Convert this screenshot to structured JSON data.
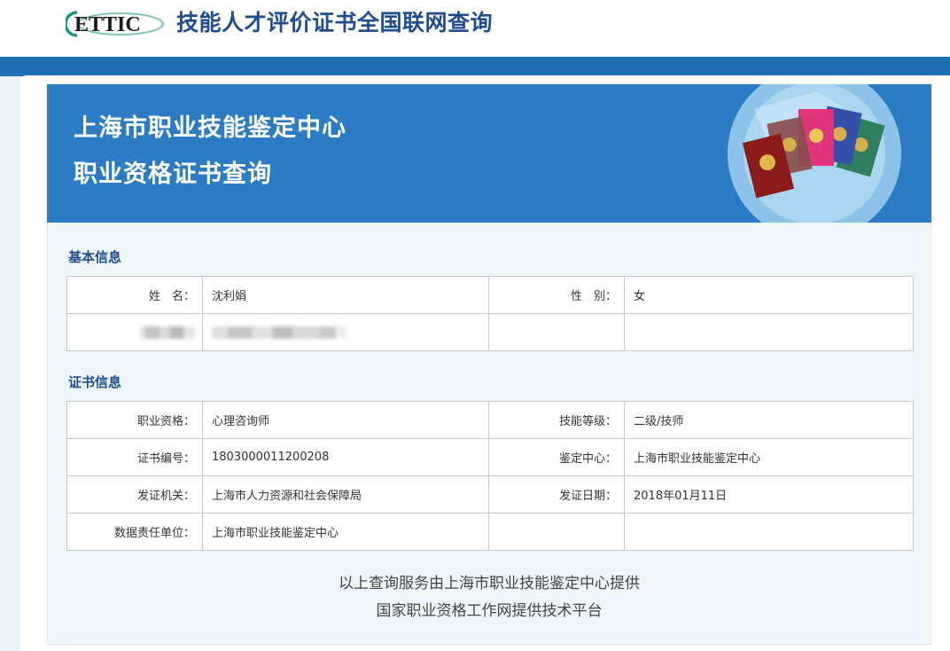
{
  "header": {
    "logo_text": "ETTIC",
    "site_title": "技能人才评价证书全国联网查询",
    "colors": {
      "brand": "#1f4d8f",
      "logo_teal": "#159a7a",
      "band": "#1f6fb4"
    }
  },
  "hero": {
    "line1": "上海市职业技能鉴定中心",
    "line2": "职业资格证书查询",
    "background": "#2b7cc4"
  },
  "basic_info": {
    "title": "基本信息",
    "rows": [
      {
        "label": "姓　名：",
        "value": "沈利娟",
        "label2": "性　别：",
        "value2": "女"
      },
      {
        "label": "",
        "value": "",
        "label2": "",
        "value2": ""
      }
    ]
  },
  "cert_info": {
    "title": "证书信息",
    "rows": [
      {
        "label": "职业资格：",
        "value": "心理咨询师",
        "label2": "技能等级：",
        "value2": "二级/技师"
      },
      {
        "label": "证书编号：",
        "value": "1803000011200208",
        "label2": "鉴定中心：",
        "value2": "上海市职业技能鉴定中心"
      },
      {
        "label": "发证机关：",
        "value": "上海市人力资源和社会保障局",
        "label2": "发证日期：",
        "value2": "2018年01月11日"
      },
      {
        "label": "数据责任单位：",
        "value": "上海市职业技能鉴定中心",
        "label2": "",
        "value2": ""
      }
    ]
  },
  "footer": {
    "line1": "以上查询服务由上海市职业技能鉴定中心提供",
    "line2": "国家职业资格工作网提供技术平台"
  }
}
